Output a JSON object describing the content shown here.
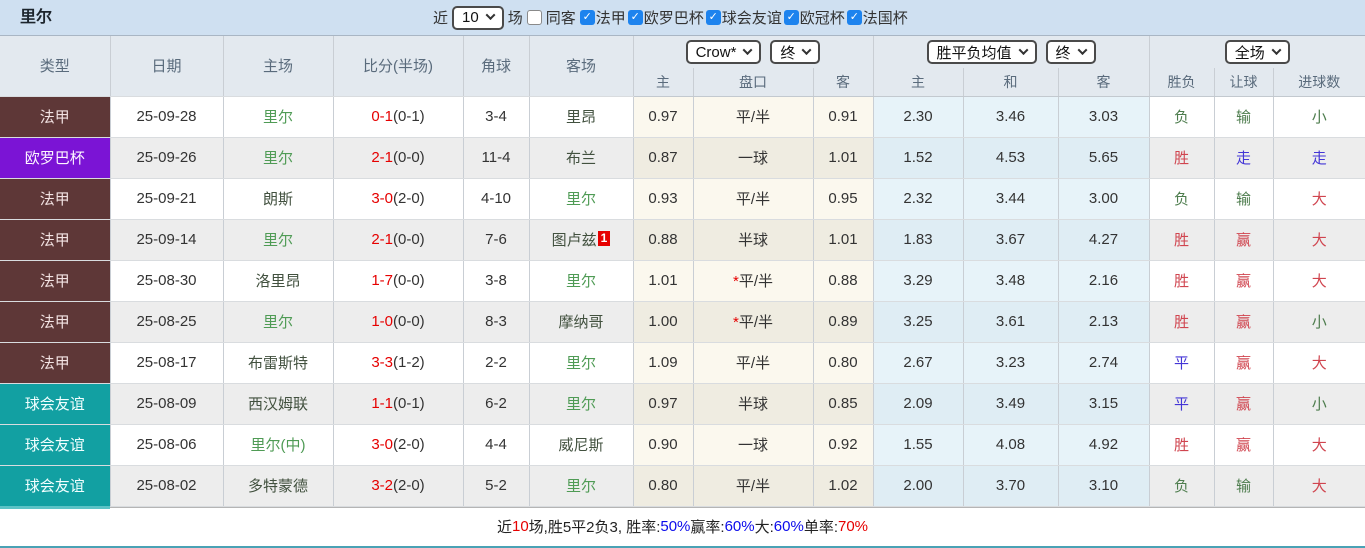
{
  "title": "里尔",
  "filter": {
    "near_label": "近",
    "near_value": "10",
    "games_label": "场",
    "same_venue_label": "同客",
    "same_venue_checked": false,
    "leagues": [
      {
        "label": "法甲",
        "checked": true
      },
      {
        "label": "欧罗巴杯",
        "checked": true
      },
      {
        "label": "球会友谊",
        "checked": true
      },
      {
        "label": "欧冠杯",
        "checked": true
      },
      {
        "label": "法国杯",
        "checked": true
      }
    ]
  },
  "table": {
    "selects": {
      "bookmaker": "Crow*",
      "odds_time": "终",
      "mean_type": "胜平负均值",
      "mean_time": "终",
      "scope": "全场"
    },
    "headers": {
      "type": "类型",
      "date": "日期",
      "home": "主场",
      "score": "比分(半场)",
      "corner": "角球",
      "away": "客场",
      "odds_home": "主",
      "odds_handicap": "盘口",
      "odds_away": "客",
      "mean_home": "主",
      "mean_draw": "和",
      "mean_away": "客",
      "result": "胜负",
      "handicap_result": "让球",
      "goals": "进球数"
    },
    "rows": [
      {
        "type": "法甲",
        "type_class": "t-ligue1",
        "date": "25-09-28",
        "home": {
          "name": "里尔",
          "focus": true
        },
        "score": {
          "full": "0-1",
          "half": "(0-1)"
        },
        "corner": "3-4",
        "away": {
          "name": "里昂",
          "focus": false
        },
        "odds": {
          "home": "0.97",
          "star": false,
          "handicap": "平/半",
          "away": "0.91"
        },
        "mean": {
          "home": "2.30",
          "draw": "3.46",
          "away": "3.03"
        },
        "result": {
          "text": "负",
          "color": "green"
        },
        "handicap_result": {
          "text": "输",
          "color": "green"
        },
        "goals": {
          "text": "小",
          "color": "green"
        }
      },
      {
        "type": "欧罗巴杯",
        "type_class": "t-europa",
        "date": "25-09-26",
        "home": {
          "name": "里尔",
          "focus": true
        },
        "score": {
          "full": "2-1",
          "half": "(0-0)"
        },
        "corner": "11-4",
        "away": {
          "name": "布兰",
          "focus": false
        },
        "odds": {
          "home": "0.87",
          "star": false,
          "handicap": "一球",
          "away": "1.01"
        },
        "mean": {
          "home": "1.52",
          "draw": "4.53",
          "away": "5.65"
        },
        "result": {
          "text": "胜",
          "color": "red"
        },
        "handicap_result": {
          "text": "走",
          "color": "blue"
        },
        "goals": {
          "text": "走",
          "color": "blue"
        }
      },
      {
        "type": "法甲",
        "type_class": "t-ligue1",
        "date": "25-09-21",
        "home": {
          "name": "朗斯",
          "focus": false
        },
        "score": {
          "full": "3-0",
          "half": "(2-0)"
        },
        "corner": "4-10",
        "away": {
          "name": "里尔",
          "focus": true
        },
        "odds": {
          "home": "0.93",
          "star": false,
          "handicap": "平/半",
          "away": "0.95"
        },
        "mean": {
          "home": "2.32",
          "draw": "3.44",
          "away": "3.00"
        },
        "result": {
          "text": "负",
          "color": "green"
        },
        "handicap_result": {
          "text": "输",
          "color": "green"
        },
        "goals": {
          "text": "大",
          "color": "red"
        }
      },
      {
        "type": "法甲",
        "type_class": "t-ligue1",
        "date": "25-09-14",
        "home": {
          "name": "里尔",
          "focus": true
        },
        "score": {
          "full": "2-1",
          "half": "(0-0)"
        },
        "corner": "7-6",
        "away": {
          "name": "图卢兹",
          "focus": false,
          "badge": "1"
        },
        "odds": {
          "home": "0.88",
          "star": false,
          "handicap": "半球",
          "away": "1.01"
        },
        "mean": {
          "home": "1.83",
          "draw": "3.67",
          "away": "4.27"
        },
        "result": {
          "text": "胜",
          "color": "red"
        },
        "handicap_result": {
          "text": "赢",
          "color": "red"
        },
        "goals": {
          "text": "大",
          "color": "red"
        }
      },
      {
        "type": "法甲",
        "type_class": "t-ligue1",
        "date": "25-08-30",
        "home": {
          "name": "洛里昂",
          "focus": false
        },
        "score": {
          "full": "1-7",
          "half": "(0-0)"
        },
        "corner": "3-8",
        "away": {
          "name": "里尔",
          "focus": true
        },
        "odds": {
          "home": "1.01",
          "star": true,
          "handicap": "平/半",
          "away": "0.88"
        },
        "mean": {
          "home": "3.29",
          "draw": "3.48",
          "away": "2.16"
        },
        "result": {
          "text": "胜",
          "color": "red"
        },
        "handicap_result": {
          "text": "赢",
          "color": "red"
        },
        "goals": {
          "text": "大",
          "color": "red"
        }
      },
      {
        "type": "法甲",
        "type_class": "t-ligue1",
        "date": "25-08-25",
        "home": {
          "name": "里尔",
          "focus": true
        },
        "score": {
          "full": "1-0",
          "half": "(0-0)"
        },
        "corner": "8-3",
        "away": {
          "name": "摩纳哥",
          "focus": false
        },
        "odds": {
          "home": "1.00",
          "star": true,
          "handicap": "平/半",
          "away": "0.89"
        },
        "mean": {
          "home": "3.25",
          "draw": "3.61",
          "away": "2.13"
        },
        "result": {
          "text": "胜",
          "color": "red"
        },
        "handicap_result": {
          "text": "赢",
          "color": "red"
        },
        "goals": {
          "text": "小",
          "color": "green"
        }
      },
      {
        "type": "法甲",
        "type_class": "t-ligue1",
        "date": "25-08-17",
        "home": {
          "name": "布雷斯特",
          "focus": false
        },
        "score": {
          "full": "3-3",
          "half": "(1-2)"
        },
        "corner": "2-2",
        "away": {
          "name": "里尔",
          "focus": true
        },
        "odds": {
          "home": "1.09",
          "star": false,
          "handicap": "平/半",
          "away": "0.80"
        },
        "mean": {
          "home": "2.67",
          "draw": "3.23",
          "away": "2.74"
        },
        "result": {
          "text": "平",
          "color": "blue"
        },
        "handicap_result": {
          "text": "赢",
          "color": "red"
        },
        "goals": {
          "text": "大",
          "color": "red"
        }
      },
      {
        "type": "球会友谊",
        "type_class": "t-friendly",
        "date": "25-08-09",
        "home": {
          "name": "西汉姆联",
          "focus": false
        },
        "score": {
          "full": "1-1",
          "half": "(0-1)"
        },
        "corner": "6-2",
        "away": {
          "name": "里尔",
          "focus": true
        },
        "odds": {
          "home": "0.97",
          "star": false,
          "handicap": "半球",
          "away": "0.85"
        },
        "mean": {
          "home": "2.09",
          "draw": "3.49",
          "away": "3.15"
        },
        "result": {
          "text": "平",
          "color": "blue"
        },
        "handicap_result": {
          "text": "赢",
          "color": "red"
        },
        "goals": {
          "text": "小",
          "color": "green"
        }
      },
      {
        "type": "球会友谊",
        "type_class": "t-friendly",
        "date": "25-08-06",
        "home": {
          "name": "里尔(中)",
          "focus": true
        },
        "score": {
          "full": "3-0",
          "half": "(2-0)"
        },
        "corner": "4-4",
        "away": {
          "name": "威尼斯",
          "focus": false
        },
        "odds": {
          "home": "0.90",
          "star": false,
          "handicap": "一球",
          "away": "0.92"
        },
        "mean": {
          "home": "1.55",
          "draw": "4.08",
          "away": "4.92"
        },
        "result": {
          "text": "胜",
          "color": "red"
        },
        "handicap_result": {
          "text": "赢",
          "color": "red"
        },
        "goals": {
          "text": "大",
          "color": "red"
        }
      },
      {
        "type": "球会友谊",
        "type_class": "t-friendly",
        "date": "25-08-02",
        "home": {
          "name": "多特蒙德",
          "focus": false
        },
        "score": {
          "full": "3-2",
          "half": "(2-0)"
        },
        "corner": "5-2",
        "away": {
          "name": "里尔",
          "focus": true
        },
        "odds": {
          "home": "0.80",
          "star": false,
          "handicap": "平/半",
          "away": "1.02"
        },
        "mean": {
          "home": "2.00",
          "draw": "3.70",
          "away": "3.10"
        },
        "result": {
          "text": "负",
          "color": "green"
        },
        "handicap_result": {
          "text": "输",
          "color": "green"
        },
        "goals": {
          "text": "大",
          "color": "red"
        }
      }
    ]
  },
  "summary": {
    "segments": [
      {
        "text": "近",
        "color": "dark"
      },
      {
        "text": "10",
        "color": "red"
      },
      {
        "text": "场,胜5平2负3, 胜率:",
        "color": "dark"
      },
      {
        "text": "50%",
        "color": "blue"
      },
      {
        "text": " 赢率:",
        "color": "dark"
      },
      {
        "text": "60%",
        "color": "blue"
      },
      {
        "text": " 大:",
        "color": "dark"
      },
      {
        "text": "60%",
        "color": "blue"
      },
      {
        "text": " 单率:",
        "color": "dark"
      },
      {
        "text": "70%",
        "color": "red"
      }
    ]
  }
}
